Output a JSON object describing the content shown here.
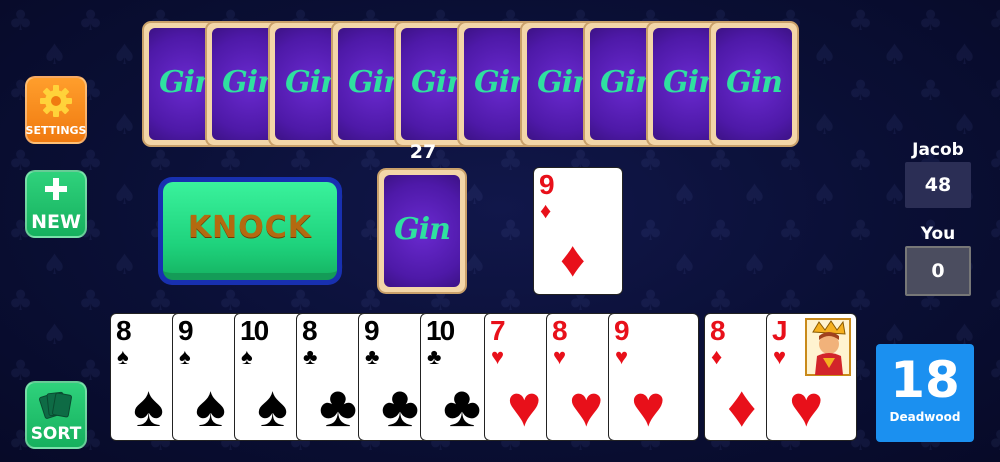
{
  "buttons": {
    "settings_label": "SETTINGS",
    "new_label": "NEW",
    "sort_label": "SORT",
    "knock_label": "KNOCK"
  },
  "card_back_text": "Gin",
  "opponent_hand_count": 10,
  "stock": {
    "count": "27",
    "back_text": "Gin"
  },
  "discard": {
    "rank": "9",
    "suit": "♦",
    "color": "red"
  },
  "player_hand": [
    {
      "rank": "8",
      "suit": "♠",
      "color": "black"
    },
    {
      "rank": "9",
      "suit": "♠",
      "color": "black"
    },
    {
      "rank": "10",
      "suit": "♠",
      "color": "black"
    },
    {
      "rank": "8",
      "suit": "♣",
      "color": "black"
    },
    {
      "rank": "9",
      "suit": "♣",
      "color": "black"
    },
    {
      "rank": "10",
      "suit": "♣",
      "color": "black"
    },
    {
      "rank": "7",
      "suit": "♥",
      "color": "red"
    },
    {
      "rank": "8",
      "suit": "♥",
      "color": "red"
    },
    {
      "rank": "9",
      "suit": "♥",
      "color": "red"
    },
    {
      "rank": "8",
      "suit": "♦",
      "color": "red"
    },
    {
      "rank": "J",
      "suit": "♥",
      "color": "red",
      "face": true
    }
  ],
  "scores": {
    "opponent": {
      "name": "Jacob",
      "score": "48"
    },
    "player": {
      "name": "You",
      "score": "0"
    }
  },
  "deadwood": {
    "value": "18",
    "label": "Deadwood"
  },
  "colors": {
    "background": "#0a0f35",
    "card_back": "#4e19a8",
    "gin_text": "#2fe0a0",
    "settings_button": "#f07a10",
    "green_button": "#16b05e",
    "knock_text": "#b46a10",
    "deadwood_box": "#1b90f0",
    "red_suit": "#e8101a"
  }
}
